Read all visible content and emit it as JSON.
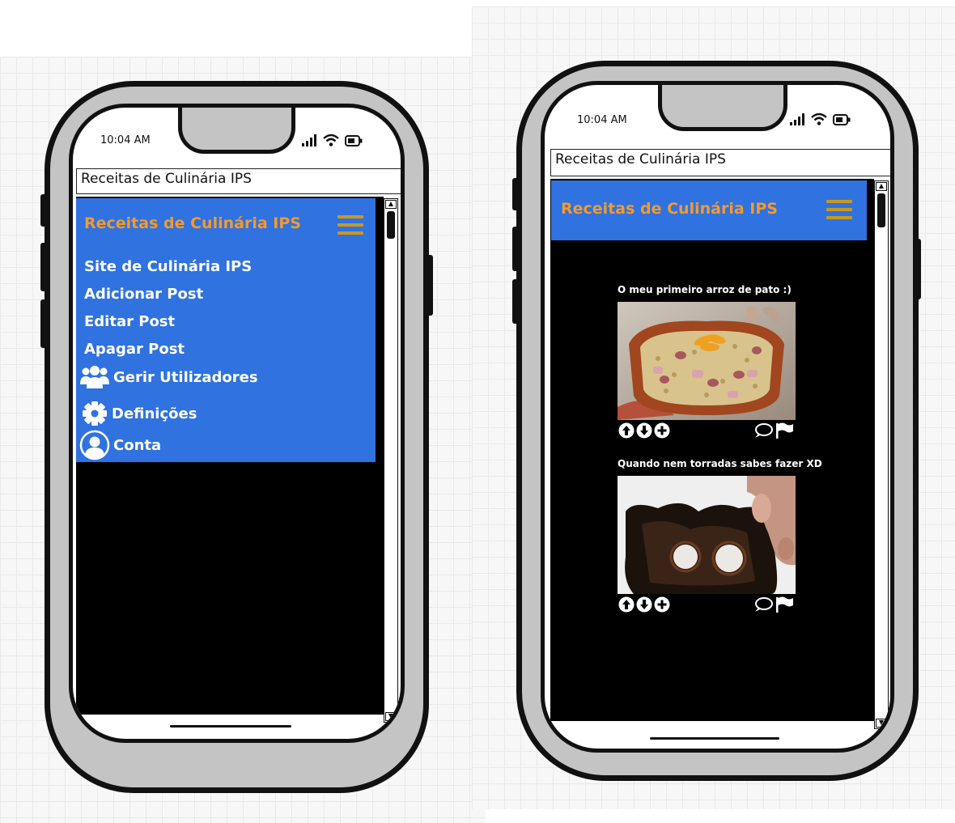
{
  "left_phone": {
    "status_bar": {
      "time": "10:04 AM",
      "icons": [
        "signal-icon",
        "wifi-icon",
        "battery-icon"
      ]
    },
    "url_bar": {
      "text": "Receitas de Culinária IPS"
    },
    "app_bar": {
      "title": "Receitas de Culinária IPS",
      "menu_icon": "hamburger-icon"
    },
    "menu": {
      "items": [
        {
          "label": "Site de Culinária IPS",
          "icon": ""
        },
        {
          "label": "Adicionar Post",
          "icon": ""
        },
        {
          "label": "Editar Post",
          "icon": ""
        },
        {
          "label": "Apagar Post",
          "icon": ""
        },
        {
          "label": "Gerir Utilizadores",
          "icon": "users-icon"
        },
        {
          "label": "Definições",
          "icon": "gear-icon"
        },
        {
          "label": "Conta",
          "icon": "user-circle-icon"
        }
      ]
    }
  },
  "right_phone": {
    "status_bar": {
      "time": "10:04 AM",
      "icons": [
        "signal-icon",
        "wifi-icon",
        "battery-icon"
      ]
    },
    "url_bar": {
      "text": "Receitas de Culinária IPS"
    },
    "app_bar": {
      "title": "Receitas de Culinária IPS",
      "menu_icon": "hamburger-icon"
    },
    "feed": {
      "posts": [
        {
          "title": "O meu primeiro arroz de pato :)",
          "image": "duck-rice-photo",
          "actions": [
            "upvote-icon",
            "downvote-icon",
            "add-icon",
            "comment-icon",
            "flag-icon"
          ]
        },
        {
          "title": "Quando nem torradas sabes fazer XD",
          "image": "burnt-toast-photo",
          "actions": [
            "upvote-icon",
            "downvote-icon",
            "add-icon",
            "comment-icon",
            "flag-icon"
          ]
        }
      ]
    }
  },
  "colors": {
    "nav_blue": "#2f72e0",
    "title_orange": "#f39a2e",
    "hamburger_gold": "#c69a1e",
    "phone_body": "#c4c4c4",
    "screen_content": "#000000"
  }
}
